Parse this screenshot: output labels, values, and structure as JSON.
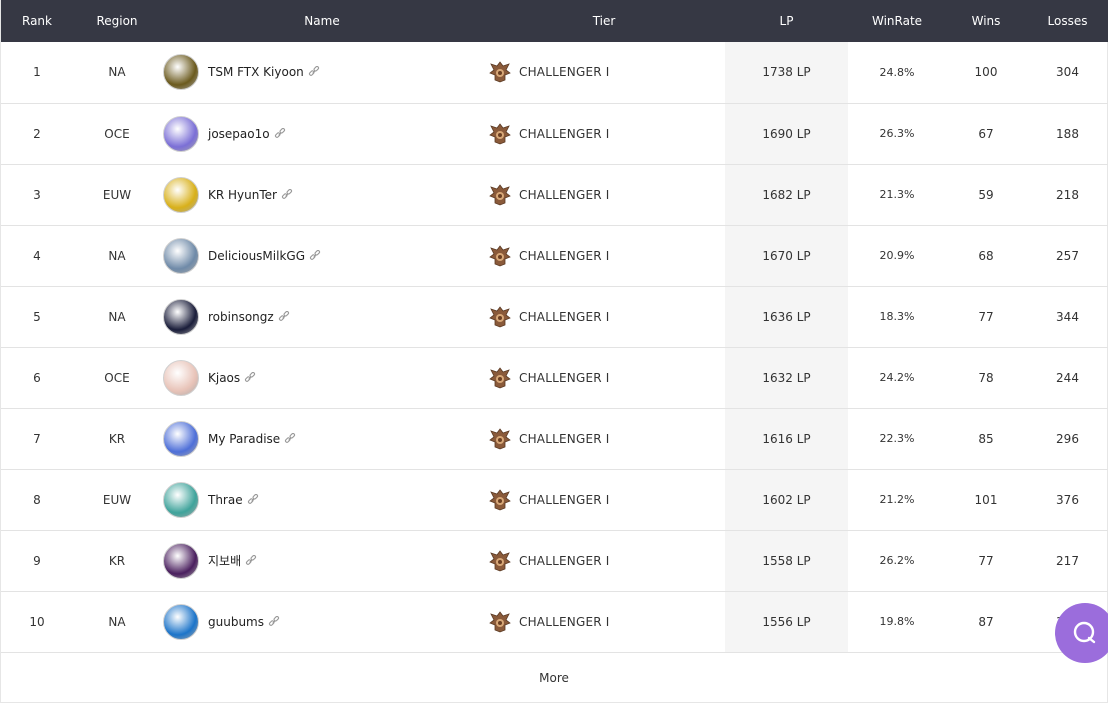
{
  "columns": {
    "rank": "Rank",
    "region": "Region",
    "name": "Name",
    "tier": "Tier",
    "lp": "LP",
    "winrate": "WinRate",
    "wins": "Wins",
    "losses": "Losses"
  },
  "rows": [
    {
      "rank": "1",
      "region": "NA",
      "name": "TSM FTX Kiyoon",
      "tier": "CHALLENGER I",
      "lp": "1738 LP",
      "winrate": "24.8%",
      "wins": "100",
      "losses": "304",
      "avatar_color": "#6b5a1e"
    },
    {
      "rank": "2",
      "region": "OCE",
      "name": "josepao1o",
      "tier": "CHALLENGER I",
      "lp": "1690 LP",
      "winrate": "26.3%",
      "wins": "67",
      "losses": "188",
      "avatar_color": "#7b6fd6"
    },
    {
      "rank": "3",
      "region": "EUW",
      "name": "KR HyunTer",
      "tier": "CHALLENGER I",
      "lp": "1682 LP",
      "winrate": "21.3%",
      "wins": "59",
      "losses": "218",
      "avatar_color": "#d8b01a"
    },
    {
      "rank": "4",
      "region": "NA",
      "name": "DeliciousMilkGG",
      "tier": "CHALLENGER I",
      "lp": "1670 LP",
      "winrate": "20.9%",
      "wins": "68",
      "losses": "257",
      "avatar_color": "#6f8aa8"
    },
    {
      "rank": "5",
      "region": "NA",
      "name": "robinsongz",
      "tier": "CHALLENGER I",
      "lp": "1636 LP",
      "winrate": "18.3%",
      "wins": "77",
      "losses": "344",
      "avatar_color": "#1a1d3a"
    },
    {
      "rank": "6",
      "region": "OCE",
      "name": "Kjaos",
      "tier": "CHALLENGER I",
      "lp": "1632 LP",
      "winrate": "24.2%",
      "wins": "78",
      "losses": "244",
      "avatar_color": "#e8c3b8"
    },
    {
      "rank": "7",
      "region": "KR",
      "name": "My Paradise",
      "tier": "CHALLENGER I",
      "lp": "1616 LP",
      "winrate": "22.3%",
      "wins": "85",
      "losses": "296",
      "avatar_color": "#4e6fd8"
    },
    {
      "rank": "8",
      "region": "EUW",
      "name": "Thrae",
      "tier": "CHALLENGER I",
      "lp": "1602 LP",
      "winrate": "21.2%",
      "wins": "101",
      "losses": "376",
      "avatar_color": "#3fa39b"
    },
    {
      "rank": "9",
      "region": "KR",
      "name": "지보배",
      "tier": "CHALLENGER I",
      "lp": "1558 LP",
      "winrate": "26.2%",
      "wins": "77",
      "losses": "217",
      "avatar_color": "#4a1f5e"
    },
    {
      "rank": "10",
      "region": "NA",
      "name": "guubums",
      "tier": "CHALLENGER I",
      "lp": "1556 LP",
      "winrate": "19.8%",
      "wins": "87",
      "losses": "353",
      "avatar_color": "#1c74c9"
    }
  ],
  "more_label": "More",
  "colors": {
    "header_bg": "#363844",
    "lp_column_bg": "#f5f5f5",
    "chat_button": "#9b6ddc"
  },
  "icons": {
    "row_link": "link-icon",
    "tier": "challenger-emblem-icon",
    "chat": "chat-bubble-icon"
  }
}
